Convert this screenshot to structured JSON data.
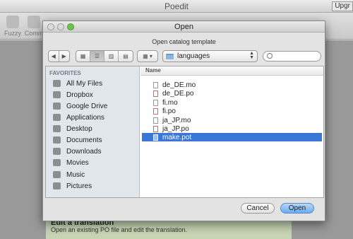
{
  "background": {
    "app_title": "Poedit",
    "upgrade_label": "Upgr",
    "toolbar": [
      {
        "label": "Fuzzy",
        "icon": "fuzzy-icon"
      },
      {
        "label": "Comm",
        "icon": "comment-icon"
      }
    ],
    "card": {
      "title": "Edit a translation",
      "description": "Open an existing PO file and edit the translation."
    }
  },
  "dialog": {
    "title": "Open",
    "prompt": "Open catalog template",
    "location": "languages",
    "search": {
      "placeholder": ""
    },
    "sidebar": {
      "header": "FAVORITES",
      "items": [
        {
          "label": "All My Files",
          "icon": "all-files-icon"
        },
        {
          "label": "Dropbox",
          "icon": "folder-icon"
        },
        {
          "label": "Google Drive",
          "icon": "folder-icon"
        },
        {
          "label": "Applications",
          "icon": "applications-icon"
        },
        {
          "label": "Desktop",
          "icon": "desktop-icon"
        },
        {
          "label": "Documents",
          "icon": "documents-icon"
        },
        {
          "label": "Downloads",
          "icon": "downloads-icon"
        },
        {
          "label": "Movies",
          "icon": "movies-icon"
        },
        {
          "label": "Music",
          "icon": "music-icon"
        },
        {
          "label": "Pictures",
          "icon": "pictures-icon"
        }
      ]
    },
    "files": {
      "column_header": "Name",
      "items": [
        {
          "name": "de_DE.mo",
          "selected": false
        },
        {
          "name": "de_DE.po",
          "selected": false
        },
        {
          "name": "fi.mo",
          "selected": false
        },
        {
          "name": "fi.po",
          "selected": false
        },
        {
          "name": "ja_JP.mo",
          "selected": false
        },
        {
          "name": "ja_JP.po",
          "selected": false
        },
        {
          "name": "make.pot",
          "selected": true
        }
      ]
    },
    "buttons": {
      "cancel": "Cancel",
      "open": "Open"
    },
    "colors": {
      "selection": "#3a76d6",
      "default_button": "#6aaaf0"
    }
  }
}
